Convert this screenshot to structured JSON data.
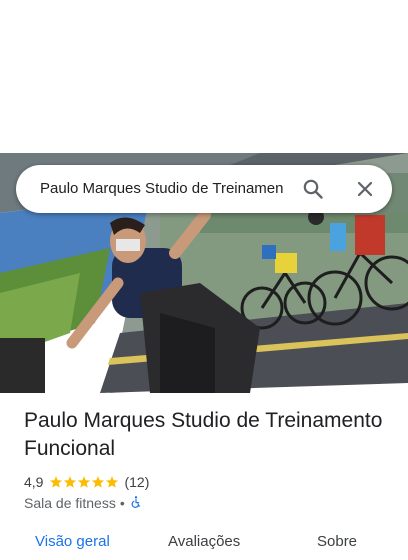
{
  "search": {
    "value": "Paulo Marques Studio de Treinamen",
    "search_icon": "search-icon",
    "close_icon": "close-icon"
  },
  "hero": {
    "image": "gym photo: woman exercising in front of cycling mural"
  },
  "place": {
    "name": "Paulo Marques Studio de Treinamento Funcional",
    "rating": "4,9",
    "stars": 5,
    "review_count": "(12)",
    "category": "Sala de fitness",
    "separator": "•",
    "accessibility_icon": "wheelchair-accessible-icon"
  },
  "tabs": [
    {
      "label": "Visão geral",
      "active": true
    },
    {
      "label": "Avaliações",
      "active": false
    },
    {
      "label": "Sobre",
      "active": false
    }
  ],
  "colors": {
    "accent": "#1a73e8",
    "star": "#fbbc04",
    "text": "#202124",
    "secondary_text": "#5f6368"
  }
}
